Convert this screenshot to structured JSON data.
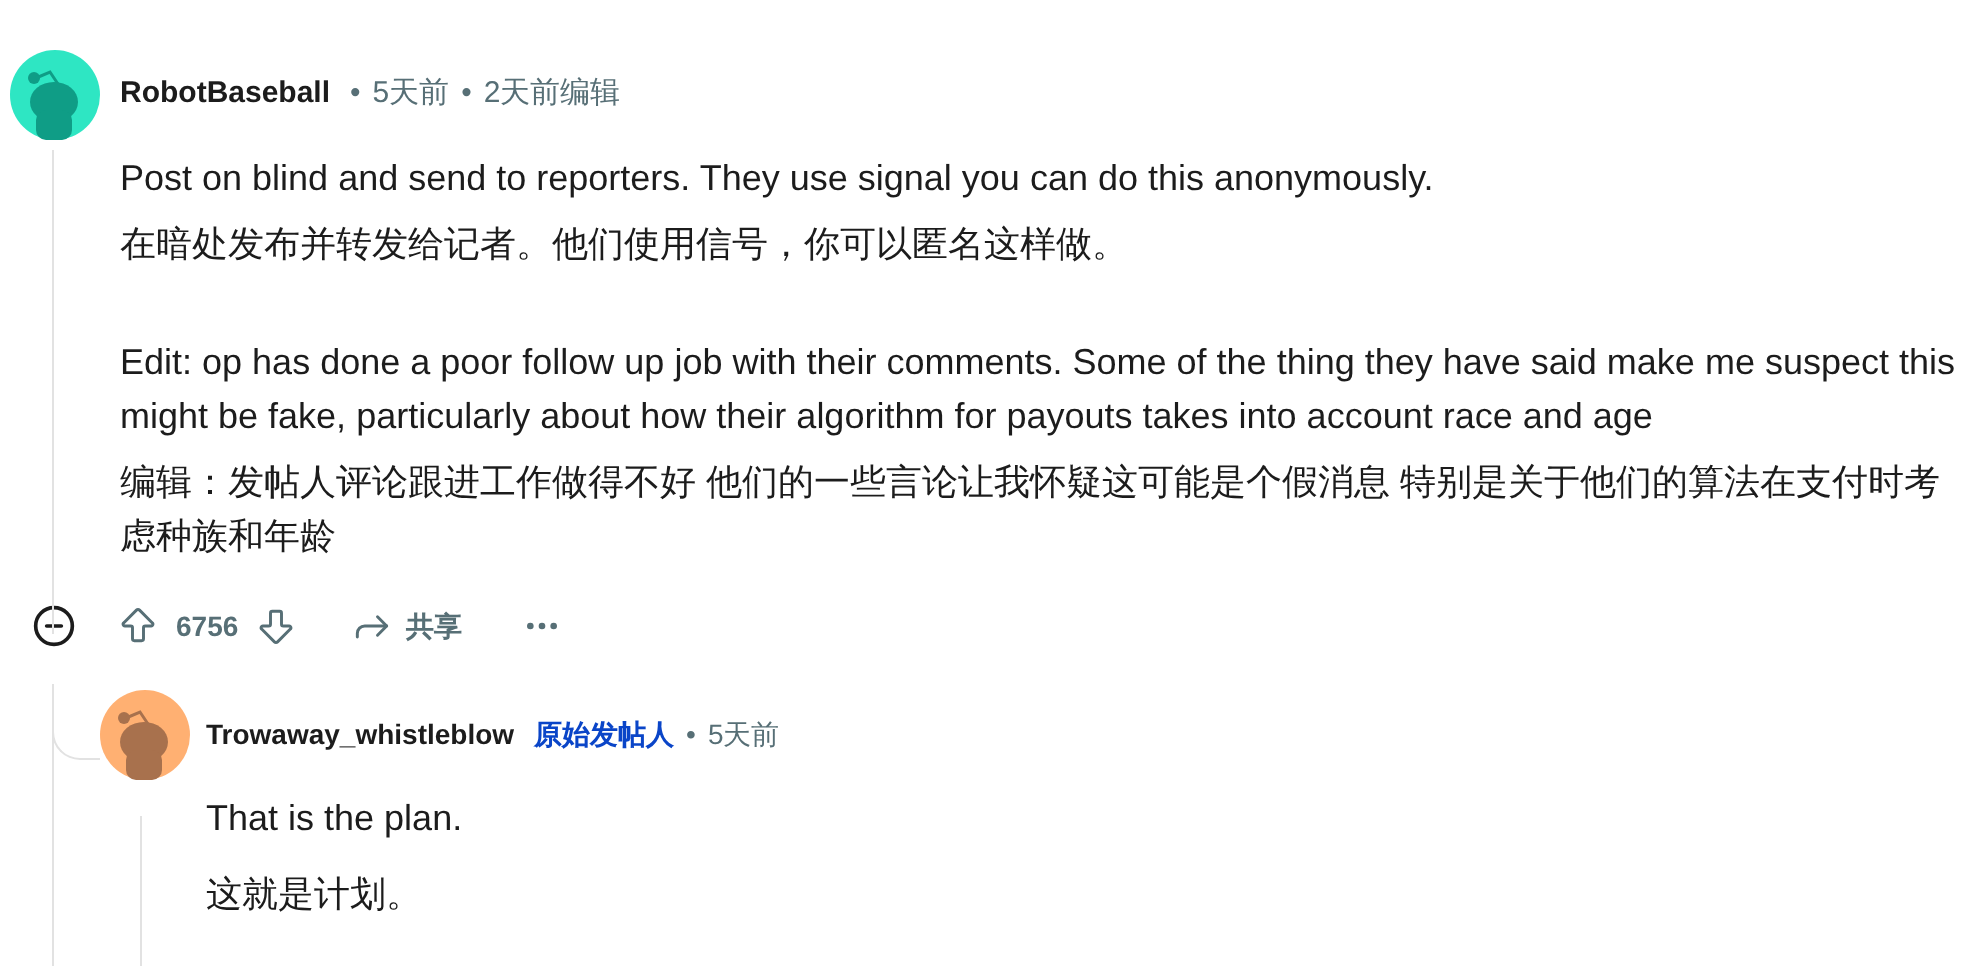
{
  "comment": {
    "author": "RobotBaseball",
    "separator": "•",
    "posted": "5天前",
    "edited": "2天前编辑",
    "paragraphs": [
      "Post on blind and send to reporters. They use signal you can do this anonymously.",
      "在暗处发布并转发给记者。他们使用信号，你可以匿名这样做。",
      "Edit: op has done a poor follow up job with their comments. Some of the thing they have said make me suspect this might be fake, particularly about how their algorithm for payouts takes into account race and age",
      "编辑：发帖人评论跟进工作做得不好 他们的一些言论让我怀疑这可能是个假消息 特别是关于他们的算法在支付时考虑种族和年龄"
    ],
    "expanded": true,
    "votes": "6756",
    "share": "共享"
  },
  "reply": {
    "author": "Trowaway_whistleblow",
    "badge": "原始发帖人",
    "separator": "•",
    "posted": "5天前",
    "paragraphs": [
      "That is the plan.",
      "这就是计划。"
    ]
  }
}
